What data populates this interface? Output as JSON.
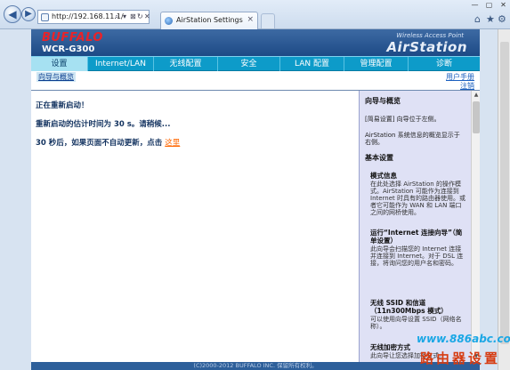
{
  "browser": {
    "address": "http://192.168.11.1/",
    "tab_title": "AirStation Settings",
    "tab_close": "×",
    "addr_tools": [
      "⌕",
      "▾",
      "⊠",
      "↻",
      "✕"
    ],
    "tool_icons": [
      "home-icon",
      "star-icon",
      "gear-icon"
    ],
    "tool_glyphs": [
      "⌂",
      "★",
      "⚙"
    ],
    "win_controls": [
      "—",
      "▢",
      "✕"
    ]
  },
  "header": {
    "brand": "BUFFALO",
    "model": "WCR-G300",
    "tagline": "Wireless Access Point",
    "product": "AirStation"
  },
  "menu": [
    {
      "label": "设置",
      "active": true
    },
    {
      "label": "Internet/LAN",
      "active": false
    },
    {
      "label": "无线配置",
      "active": false
    },
    {
      "label": "安全",
      "active": false
    },
    {
      "label": "LAN 配置",
      "active": false
    },
    {
      "label": "管理配置",
      "active": false
    },
    {
      "label": "诊断",
      "active": false
    }
  ],
  "subnav": {
    "left": "向导与概览",
    "user_manual": "用户手册",
    "logout": "注销"
  },
  "main": {
    "line1": "正在重新启动！",
    "line2": "重新启动的估计时间为  30 s。请稍候...",
    "line3": "30 秒后，如果页面不自动更新，点击",
    "link": "这里"
  },
  "help": {
    "title": "向导与概览",
    "p1": "[简易设置] 向导位于左侧。",
    "p2": "AirStation 系统信息的概览显示于右侧。",
    "section": "基本设置",
    "items": [
      {
        "title": "模式信息",
        "text": "在此处选择 AirStation 的操作模式。AirStation 可能作为连接到 Internet 时具有的路由器使用。或者它可能作为 WAN 和 LAN 端口之间的网桥使用。"
      },
      {
        "title": "运行“Internet 连接向导”（简单设置）",
        "text": "此向导会扫描您的 Internet 连接并连接到 Internet。对于 DSL 连接，将询问您的用户名和密码。"
      },
      {
        "title": "无线 SSID 和信道（11n300Mbps 模式）",
        "text": "可以使用向导设置 SSID（网络名称）。"
      },
      {
        "title": "无线加密方式",
        "text": "此向导让您选择加密方式。"
      }
    ]
  },
  "footer": "(C)2000-2012 BUFFALO INC. 保留所有权利。",
  "watermark": {
    "url": "www.886abc.com",
    "text": "路由器设置"
  },
  "colors": {
    "brand_red": "#e8232a",
    "menu_bg": "#0d9bc9",
    "header_bg": "#1d4a86",
    "link_orange": "#ff6600"
  }
}
